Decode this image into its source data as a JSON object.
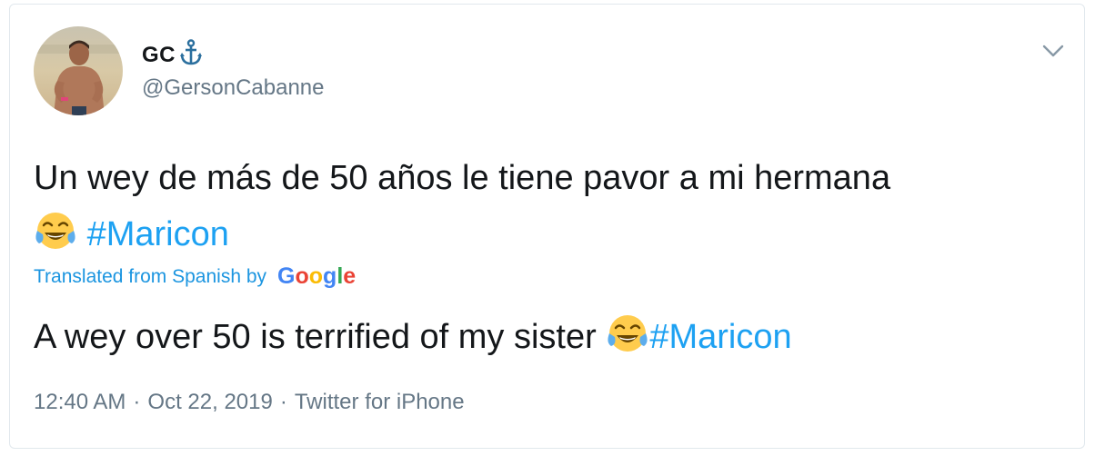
{
  "user": {
    "display_name": "GC",
    "handle": "@GersonCabanne",
    "name_icon": "anchor-icon",
    "avatar_icon": "profile-photo"
  },
  "tweet": {
    "original_text": "Un wey de más de 50 años le tiene pavor a mi hermana",
    "original_hashtag": "#Maricon",
    "emoji": "face-with-tears-of-joy",
    "translated_label": "Translated from Spanish by",
    "translator_logo_text": [
      "G",
      "o",
      "o",
      "g",
      "l",
      "e"
    ],
    "translator_logo_colors": [
      "#4285f4",
      "#ea4335",
      "#fbbc05",
      "#4285f4",
      "#34a853",
      "#ea4335"
    ],
    "translated_text": "A wey over 50 is terrified of my sister",
    "translated_hashtag": "#Maricon"
  },
  "meta": {
    "time": "12:40 AM",
    "date": "Oct 22, 2019",
    "source": "Twitter for iPhone",
    "separator": "·"
  },
  "colors": {
    "text": "#14171a",
    "secondary": "#657786",
    "link": "#1da1f2",
    "border": "#e1e8ed"
  }
}
